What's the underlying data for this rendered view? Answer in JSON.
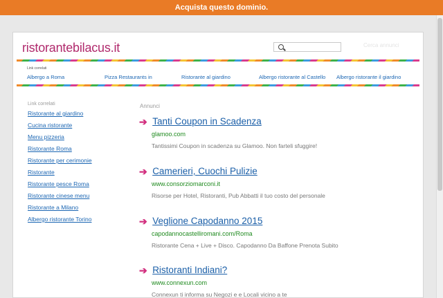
{
  "topbar": {
    "text": "Acquista questo dominio."
  },
  "header": {
    "site_name": "ristorantebilacus.it",
    "search": {
      "value": "",
      "placeholder": "",
      "button_label": "Cerca annunci"
    },
    "related_title": "Link correlati",
    "links": [
      "Albergo a Roma",
      "Pizza Restaurants in",
      "Ristorante al giardino",
      "Albergo ristorante al Castello",
      "Albergo ristorante il giardino"
    ]
  },
  "sidebar": {
    "title": "Link correlati",
    "items": [
      "Ristorante al giardino",
      "Cucina ristorante",
      "Menu pizzeria",
      "Ristorante Roma",
      "Ristorante per cerimonie",
      "Ristorante",
      "Ristorante pesce Roma",
      "Ristorante cinese menu",
      "Ristorante a Milano",
      "Albergo ristorante Torino"
    ]
  },
  "ads": {
    "label": "Annunci",
    "arrow_icon": "arrow-right-icon",
    "items": [
      {
        "title": "Tanti Coupon in Scadenza",
        "url": "glamoo.com",
        "description": "Tantissimi Coupon in scadenza su Glamoo. Non farteli sfuggire!"
      },
      {
        "title": "Camerieri, Cuochi Pulizie",
        "url": "www.consorziomarconi.it",
        "description": "Risorse per Hotel, Ristoranti, Pub Abbatti il tuo costo del personale"
      },
      {
        "title": "Veglione Capodanno 2015",
        "url": "capodannocastelliromani.com/Roma",
        "description": "Ristorante Cena + Live + Disco. Capodanno Da Baffone Prenota Subito"
      },
      {
        "title": "Ristoranti Indiani?",
        "url": "www.connexun.com",
        "description": "Connexun ti informa su Negozi e e Locali vicino a te"
      }
    ]
  },
  "colors": {
    "topbar": "#e97b26",
    "site_name": "#b0296c",
    "link": "#1b66b3",
    "ad_url": "#1f8a1f",
    "arrow": "#d2307f"
  }
}
